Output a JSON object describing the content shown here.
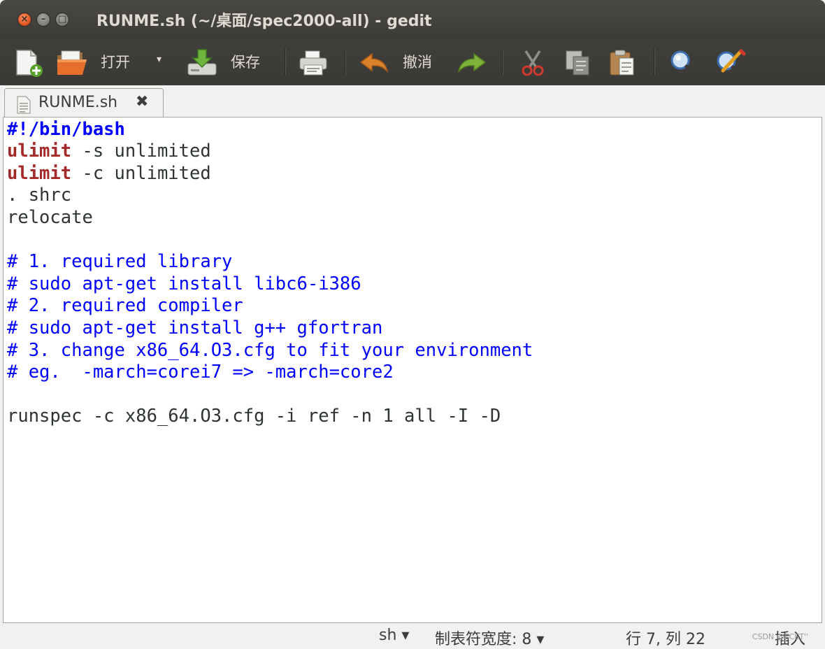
{
  "window": {
    "title": "RUNME.sh (~/桌面/spec2000-all) - gedit",
    "close_glyph": "×",
    "minimize_glyph": "–",
    "maximize_glyph": "□"
  },
  "toolbar": {
    "new_icon": "new-document-icon",
    "open_icon": "open-folder-icon",
    "open_label": "打开",
    "open_dropdown_glyph": "▾",
    "save_icon": "save-icon",
    "save_label": "保存",
    "print_icon": "printer-icon",
    "undo_icon": "undo-arrow-icon",
    "undo_label": "撤消",
    "redo_icon": "redo-arrow-icon",
    "cut_icon": "scissors-icon",
    "copy_icon": "copy-icon",
    "paste_icon": "paste-icon",
    "find_icon": "search-icon",
    "replace_icon": "search-replace-icon"
  },
  "tab": {
    "label": "RUNME.sh",
    "close_glyph": "✖",
    "icon": "text-file-icon"
  },
  "editor": {
    "lines": [
      {
        "shebang": "#!/bin/bash"
      },
      {
        "keyword": "ulimit",
        "rest": " -s unlimited"
      },
      {
        "keyword": "ulimit",
        "rest": " -c unlimited"
      },
      {
        "plain": ". shrc"
      },
      {
        "plain": "relocate"
      },
      {
        "plain": ""
      },
      {
        "comment": "# 1. required library"
      },
      {
        "comment": "# sudo apt-get install libc6-i386"
      },
      {
        "comment": "# 2. required compiler"
      },
      {
        "comment": "# sudo apt-get install g++ gfortran"
      },
      {
        "comment": "# 3. change x86_64.O3.cfg to fit your environment"
      },
      {
        "comment": "# eg.  -march=corei7 => -march=core2"
      },
      {
        "plain": ""
      },
      {
        "plain": "runspec -c x86_64.O3.cfg -i ref -n 1 all -I -D"
      }
    ],
    "colors": {
      "keyword": "#a52a2a",
      "comment": "#0000ff",
      "text": "#2e3436"
    }
  },
  "statusbar": {
    "language": "sh ▾",
    "tab_width": "制表符宽度: 8 ▾",
    "position": "行 7, 列 22",
    "mode": "插入",
    "watermark": "CSDN @ECET''"
  }
}
